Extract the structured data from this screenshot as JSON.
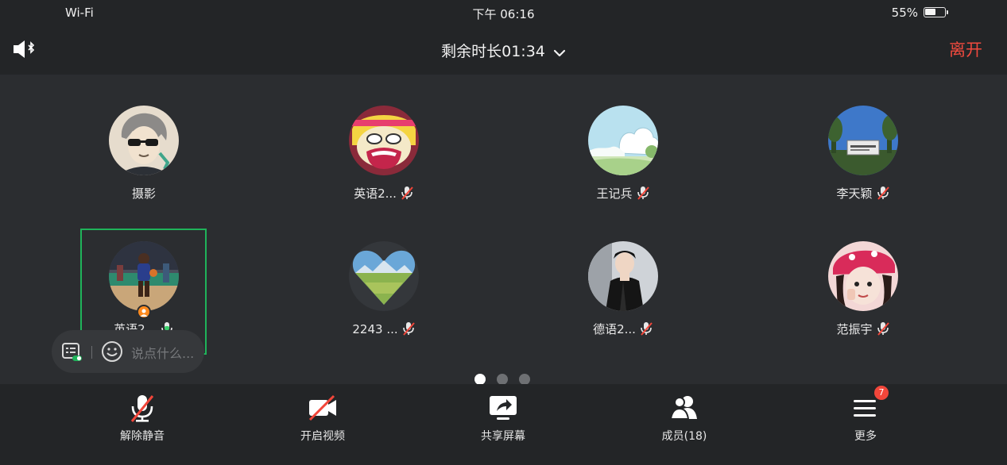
{
  "status_bar": {
    "wifi": "Wi-Fi",
    "time": "下午 06:16",
    "battery": "55%",
    "battery_level": 0.55
  },
  "header": {
    "speaker_icon": "speaker-bluetooth-icon",
    "title": "剩余时长01:34",
    "title_icon": "chevron-down-icon",
    "leave_label": "离开",
    "leave_color": "#f04a3e"
  },
  "participants": [
    {
      "name": "摄影",
      "mic": "none",
      "avatar": "cartoon-sunglasses"
    },
    {
      "name": "英语2...",
      "mic": "muted",
      "avatar": "cartoon-girl-yellow"
    },
    {
      "name": "王记兵",
      "mic": "muted",
      "avatar": "sky-clouds"
    },
    {
      "name": "李天颖",
      "mic": "muted",
      "avatar": "sign-trees"
    },
    {
      "name": "英语2...",
      "mic": "active",
      "avatar": "basketball-court",
      "host": true,
      "selected": true
    },
    {
      "name": "2243 ...",
      "mic": "muted",
      "avatar": "heart-landscape"
    },
    {
      "name": "德语2...",
      "mic": "muted",
      "avatar": "person-dark"
    },
    {
      "name": "范振宇",
      "mic": "muted",
      "avatar": "girl-pink-hat"
    }
  ],
  "chat": {
    "placeholder": "说点什么...",
    "left_icon": "chat-list-toggle-icon",
    "emoji_icon": "emoji-icon"
  },
  "pagination": {
    "current": 1,
    "total": 3
  },
  "toolbar": [
    {
      "label": "解除静音",
      "icon": "mic-muted-icon"
    },
    {
      "label": "开启视频",
      "icon": "video-off-icon"
    },
    {
      "label": "共享屏幕",
      "icon": "share-screen-icon"
    },
    {
      "label": "成员(18)",
      "icon": "members-icon"
    },
    {
      "label": "更多",
      "icon": "more-menu-icon",
      "badge": "7"
    }
  ],
  "colors": {
    "accent_green": "#1fb35a",
    "mute_red": "#f2463a",
    "background": "#2b2d30",
    "bars": "#232527"
  }
}
